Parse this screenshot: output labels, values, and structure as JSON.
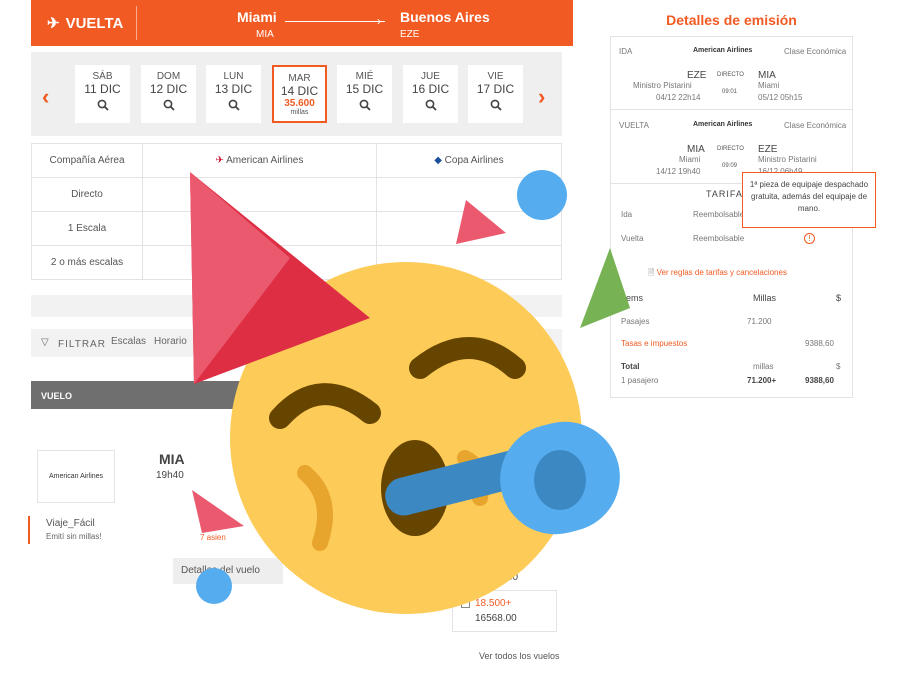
{
  "header": {
    "direction": "VUELTA",
    "origin_city": "Miami",
    "origin_code": "MIA",
    "dest_city": "Buenos Aires",
    "dest_code": "EZE"
  },
  "days": [
    {
      "wd": "SÁB",
      "date": "11 DIC"
    },
    {
      "wd": "DOM",
      "date": "12 DIC"
    },
    {
      "wd": "LUN",
      "date": "13 DIC"
    },
    {
      "wd": "MAR",
      "date": "14 DIC",
      "price": "35.600",
      "unit": "millas"
    },
    {
      "wd": "MIÉ",
      "date": "15 DIC"
    },
    {
      "wd": "JUE",
      "date": "16 DIC"
    },
    {
      "wd": "VIE",
      "date": "17 DIC"
    }
  ],
  "matrix": {
    "col_header": "Compañía Aérea",
    "airline1": "American Airlines",
    "airline2": "Copa Airlines",
    "rows": [
      "Directo",
      "1 Escala",
      "2 o más escalas"
    ]
  },
  "filter": {
    "label": "FILTRAR",
    "escalas": "Escalas",
    "horario": "Horario"
  },
  "results": {
    "header": "VUELO",
    "airline_logo": "American Airlines",
    "origin": "MIA",
    "time": "19h40",
    "promo_title": "Viaje_Fácil",
    "promo_sub": "Emití sin millas!",
    "details_btn": "Detalles del vuelo",
    "price_miles": "18.500+",
    "price_money": "16568.00",
    "price_partial": "00",
    "see_all": "Ver todos los vuelos",
    "seats": "7 asien"
  },
  "panel": {
    "title": "Detalles de emisión",
    "ida": {
      "label": "IDA",
      "airline": "American Airlines",
      "class": "Clase Económica",
      "from": "EZE",
      "from_name": "Ministro Pistarini",
      "from_dt": "04/12 22h14",
      "direct": "DIRECTO",
      "dur": "09:01",
      "to": "MIA",
      "to_name": "Miami",
      "to_dt": "05/12 05h15"
    },
    "vuelta": {
      "label": "VUELTA",
      "airline": "American Airlines",
      "class": "Clase Económica",
      "from": "MIA",
      "from_name": "Miami",
      "from_dt": "14/12 19h40",
      "direct": "DIRECTO",
      "dur": "09:09",
      "to": "EZE",
      "to_name": "Ministro Pistarini",
      "to_dt": "16/12 06h49"
    },
    "tarifa": "TARIFA",
    "ida_row": "Ida",
    "vuelta_row": "Vuelta",
    "reemb": "Reembolsable",
    "rules": "Ver reglas de tarifas y cancelaciones",
    "items": "Items",
    "millas": "Millas",
    "dollar": "$",
    "pasajes": "Pasajes",
    "pasajes_m": "71.200",
    "tasas": "Tasas e impuestos",
    "tasas_v": "9388,60",
    "total": "Total",
    "millas_l": "millas",
    "pax": "1 pasajero",
    "total_m": "71.200+",
    "total_v": "9388,60"
  },
  "tooltip": "1ª pieza de equipaje despachado gratuita, además del equipaje de mano.",
  "colors": {
    "accent": "#f15a22"
  }
}
